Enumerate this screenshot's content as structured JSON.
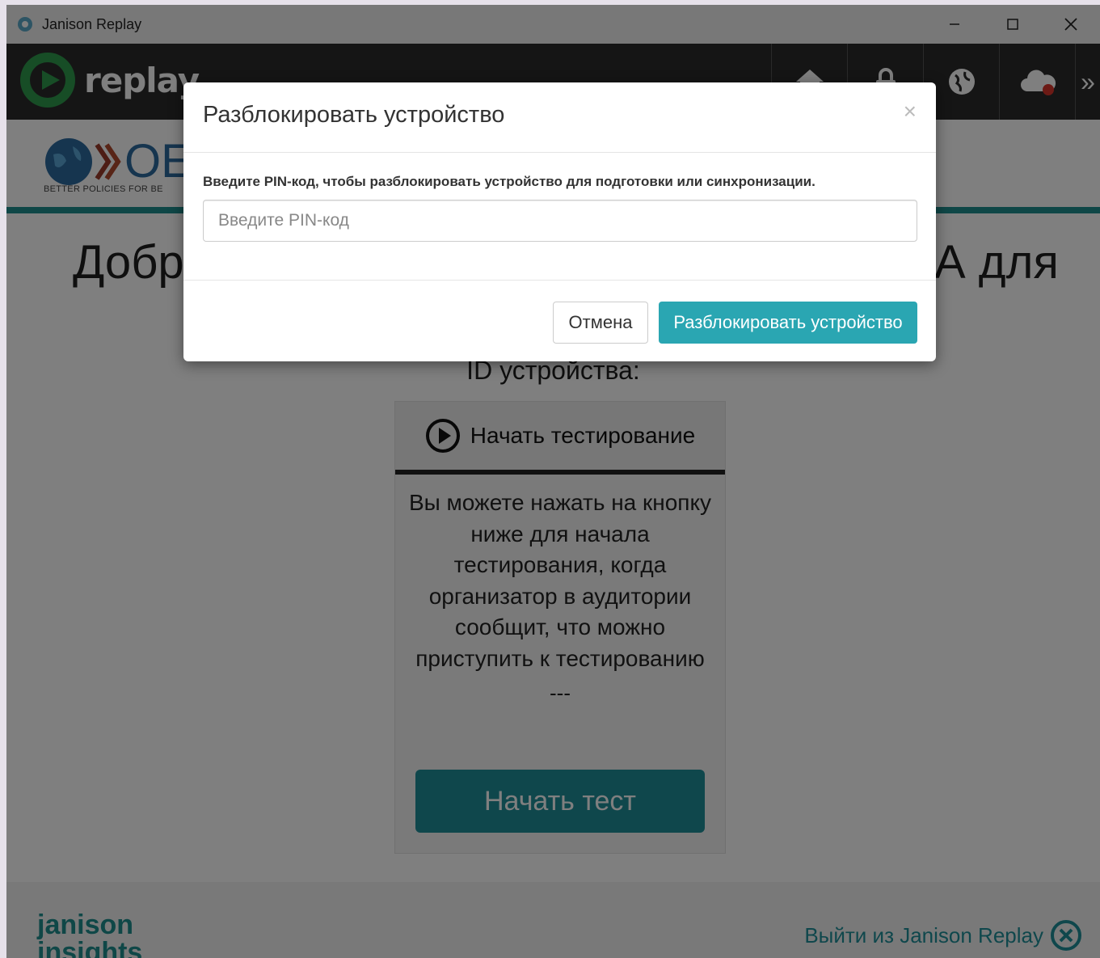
{
  "window": {
    "title": "Janison Replay"
  },
  "header": {
    "logo_text": "replay"
  },
  "org": {
    "logo_text": "OE",
    "tagline": "BETTER POLICIES FOR BE"
  },
  "main": {
    "welcome_visible_left": "Добр",
    "welcome_visible_right": "А для",
    "device_id_label": "ID устройства:",
    "panel_title": "Начать тестирование",
    "panel_text": "Вы можете нажать на кнопку ниже для начала тестирования, когда организатор в аудитории сообщит, что можно приступить к тестированию",
    "dashes": "---",
    "start_button": "Начать тест"
  },
  "footer": {
    "logo_line1": "janison",
    "logo_line2": "insights",
    "exit_link": "Выйти из Janison Replay"
  },
  "modal": {
    "title": "Разблокировать устройство",
    "close": "×",
    "instruction": "Введите PIN-код, чтобы разблокировать устройство для подготовки или синхронизации.",
    "pin_placeholder": "Введите PIN-код",
    "pin_value": "",
    "cancel_button": "Отмена",
    "unlock_button": "Разблокировать устройство"
  },
  "colors": {
    "accent": "#2aa6b2",
    "teal": "#1f8f8f",
    "header_bg": "#2b2b2b"
  },
  "icons": [
    "app-icon",
    "replay-logo-icon",
    "home-icon",
    "lock-icon",
    "globe-icon",
    "cloud-icon",
    "expand-icon",
    "play-circle-icon",
    "exit-icon"
  ]
}
